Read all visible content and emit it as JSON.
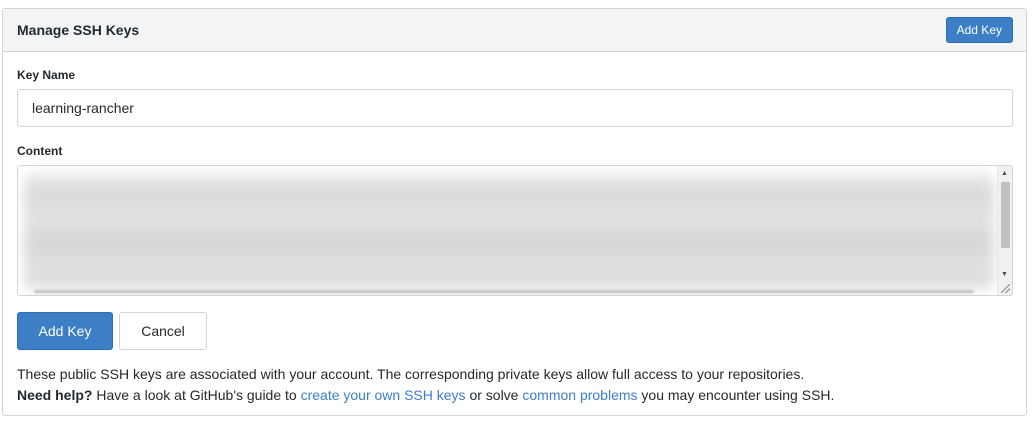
{
  "panel": {
    "title": "Manage SSH Keys",
    "add_key_header_label": "Add Key"
  },
  "form": {
    "key_name_label": "Key Name",
    "key_name_value": "learning-rancher",
    "content_label": "Content",
    "content_blurred": true
  },
  "actions": {
    "submit_label": "Add Key",
    "cancel_label": "Cancel"
  },
  "help": {
    "line1": "These public SSH keys are associated with your account. The corresponding private keys allow full access to your repositories.",
    "need_help": "Need help?",
    "text_before_link1": " Have a look at GitHub's guide to ",
    "link1": "create your own SSH keys",
    "text_between": " or solve ",
    "link2": "common problems",
    "text_after": " you may encounter using SSH."
  },
  "colors": {
    "accent": "#3d7fc6",
    "border": "#d1d5da",
    "header_bg": "#f3f4f6"
  },
  "icons": {
    "scroll_up": "triangle-up-icon",
    "scroll_down": "triangle-down-icon",
    "resize": "resize-grip-icon"
  }
}
